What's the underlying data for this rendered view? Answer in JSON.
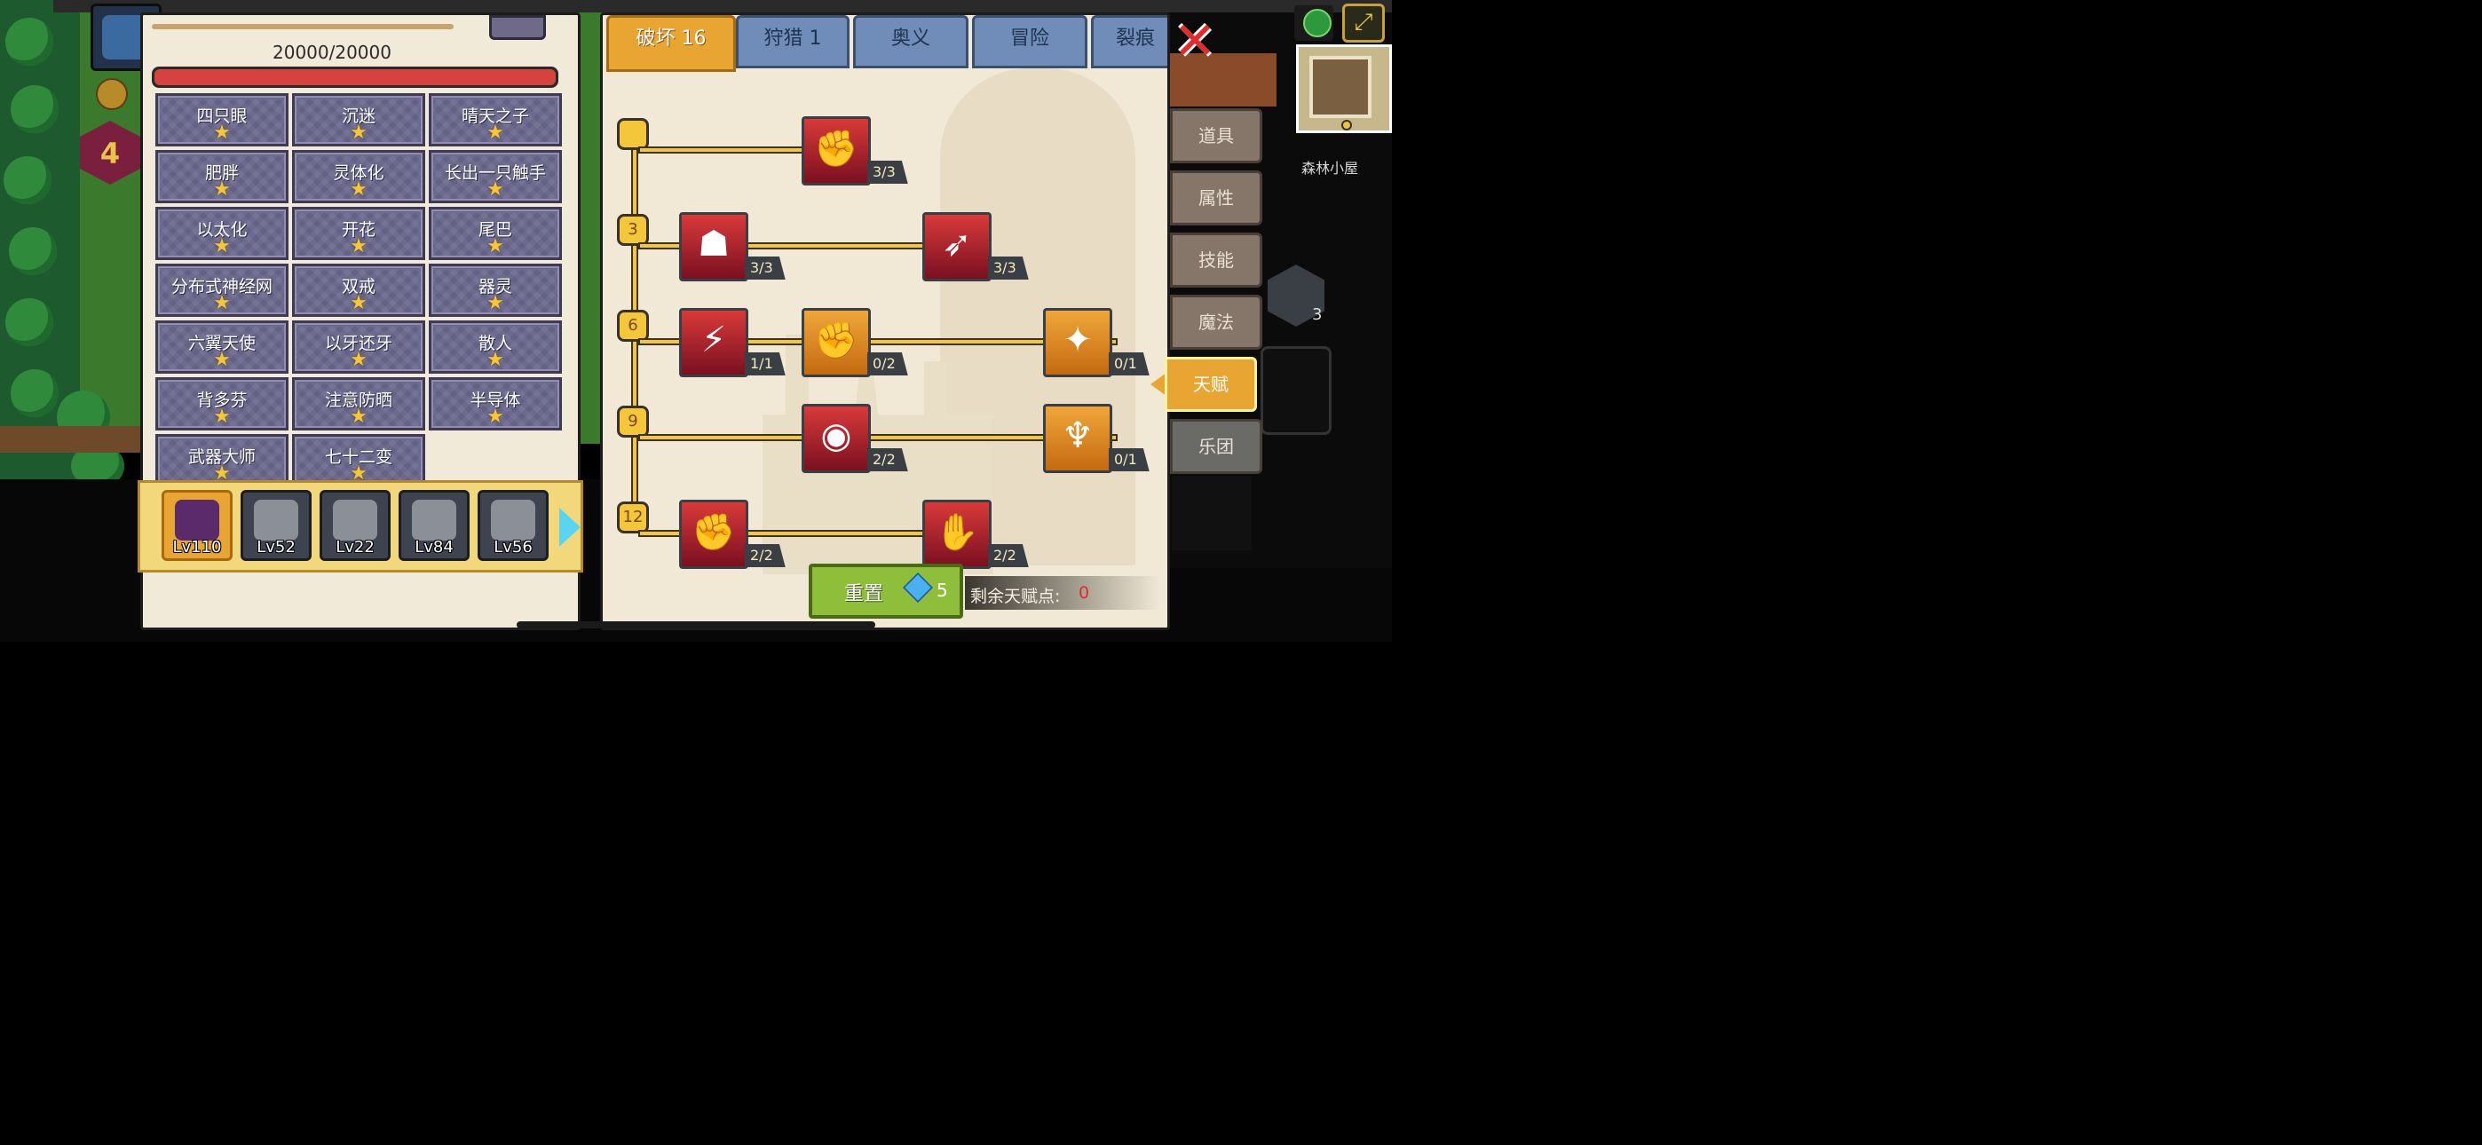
{
  "background": {
    "map_label": "森林小屋",
    "player_level": "4",
    "skill_hex_count": "3"
  },
  "left_panel": {
    "hp_text": "20000/20000",
    "hp_fraction": 1.0,
    "traits": [
      {
        "name": "四只眼",
        "stars": "★"
      },
      {
        "name": "沉迷",
        "stars": "★"
      },
      {
        "name": "晴天之子",
        "stars": "★"
      },
      {
        "name": "肥胖",
        "stars": "★"
      },
      {
        "name": "灵体化",
        "stars": "★"
      },
      {
        "name": "长出一只触手",
        "stars": "★"
      },
      {
        "name": "以太化",
        "stars": "★"
      },
      {
        "name": "开花",
        "stars": "★"
      },
      {
        "name": "尾巴",
        "stars": "★"
      },
      {
        "name": "分布式神经网",
        "stars": "★"
      },
      {
        "name": "双戒",
        "stars": "★"
      },
      {
        "name": "器灵",
        "stars": "★"
      },
      {
        "name": "六翼天使",
        "stars": "★"
      },
      {
        "name": "以牙还牙",
        "stars": "★"
      },
      {
        "name": "散人",
        "stars": "★"
      },
      {
        "name": "背多芬",
        "stars": "★"
      },
      {
        "name": "注意防晒",
        "stars": "★"
      },
      {
        "name": "半导体",
        "stars": "★"
      },
      {
        "name": "武器大师",
        "stars": "★"
      },
      {
        "name": "七十二变",
        "stars": "★"
      }
    ],
    "pets": [
      {
        "level": "Lv110"
      },
      {
        "level": "Lv52"
      },
      {
        "level": "Lv22"
      },
      {
        "level": "Lv84"
      },
      {
        "level": "Lv56"
      }
    ]
  },
  "talent_panel": {
    "tabs": [
      {
        "label": "破坏 16"
      },
      {
        "label": "狩猎 1"
      },
      {
        "label": "奥义"
      },
      {
        "label": "冒险"
      },
      {
        "label": "裂痕"
      }
    ],
    "tier_nodes": [
      "",
      "3",
      "6",
      "9",
      "12"
    ],
    "talents": [
      {
        "icon": "arm-wrestle-icon",
        "count": "3/3",
        "color": "red"
      },
      {
        "icon": "muscle-body-icon",
        "count": "3/3",
        "color": "red"
      },
      {
        "icon": "arrow-strike-icon",
        "count": "3/3",
        "color": "red"
      },
      {
        "icon": "card-break-icon",
        "count": "1/1",
        "color": "red"
      },
      {
        "icon": "punch-wind-icon",
        "count": "0/2",
        "color": "orange"
      },
      {
        "icon": "splash-slash-icon",
        "count": "0/1",
        "color": "orange"
      },
      {
        "icon": "ripple-orb-icon",
        "count": "2/2",
        "color": "red"
      },
      {
        "icon": "bat-drop-icon",
        "count": "0/1",
        "color": "orange"
      },
      {
        "icon": "raised-fist-icon",
        "count": "2/2",
        "color": "red"
      },
      {
        "icon": "claw-hand-icon",
        "count": "2/2",
        "color": "red"
      }
    ],
    "reset_label": "重置",
    "reset_cost": "5",
    "remaining_label": "剩余天赋点:",
    "remaining_value": "0"
  },
  "side_menu": [
    {
      "label": "道具"
    },
    {
      "label": "属性"
    },
    {
      "label": "技能"
    },
    {
      "label": "魔法"
    },
    {
      "label": "天赋"
    },
    {
      "label": "乐团"
    }
  ],
  "colors": {
    "accent": "#e8a531",
    "talent_red": "#d93a3a",
    "hp_red": "#d6423f",
    "remaining_red": "#e02a2a"
  }
}
